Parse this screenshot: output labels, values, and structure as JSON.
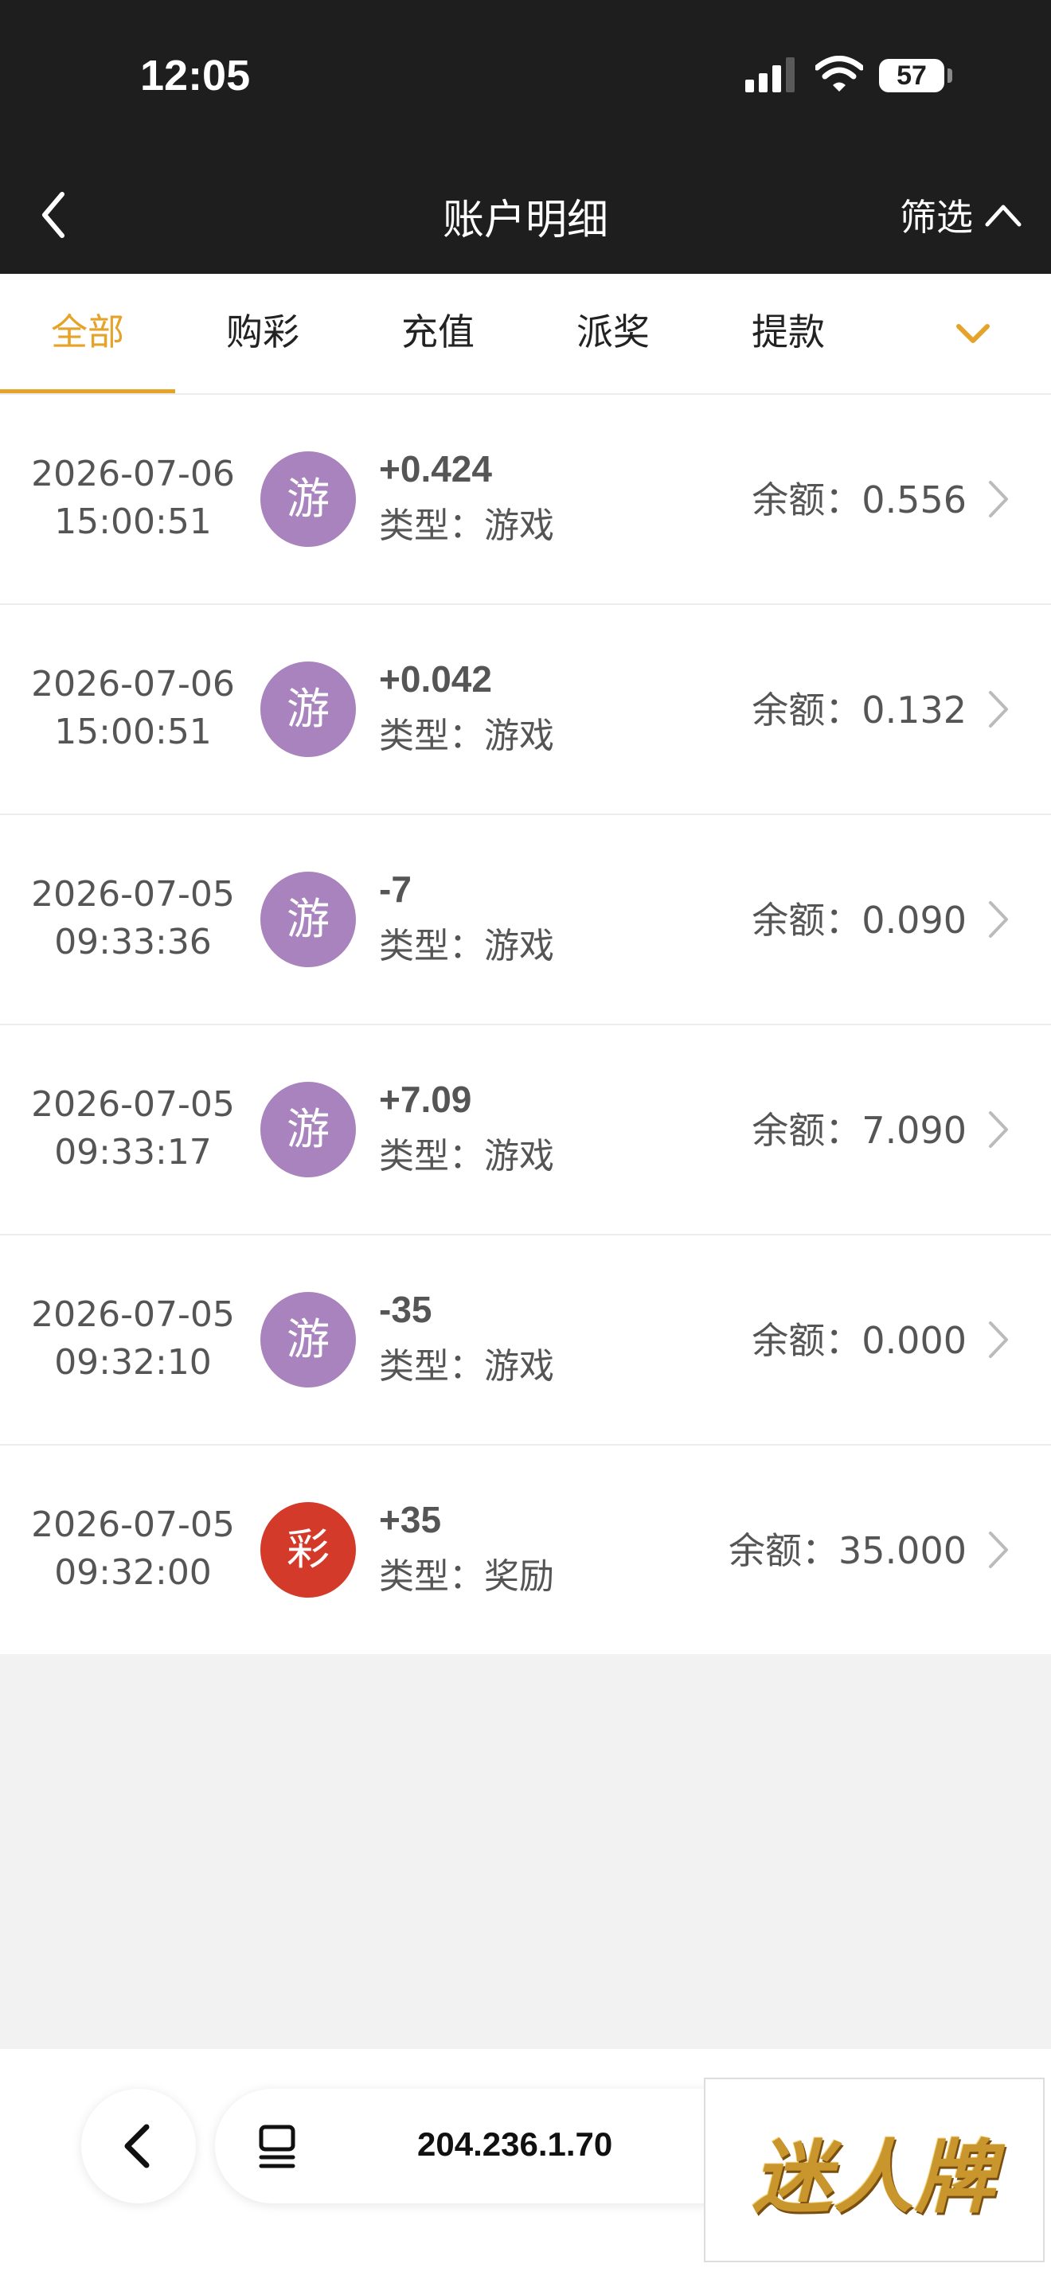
{
  "status_bar": {
    "time": "12:05",
    "battery": "57"
  },
  "navbar": {
    "title": "账户明细",
    "filter_label": "筛选"
  },
  "tabs": [
    {
      "label": "全部",
      "active": true
    },
    {
      "label": "购彩",
      "active": false
    },
    {
      "label": "充值",
      "active": false
    },
    {
      "label": "派奖",
      "active": false
    },
    {
      "label": "提款",
      "active": false
    }
  ],
  "records": [
    {
      "date": "2026-07-06",
      "time": "15:00:51",
      "badge": "游",
      "badge_color": "#a983bd",
      "amount": "+0.424",
      "type": "类型：游戏",
      "balance": "余额：0.556"
    },
    {
      "date": "2026-07-06",
      "time": "15:00:51",
      "badge": "游",
      "badge_color": "#a983bd",
      "amount": "+0.042",
      "type": "类型：游戏",
      "balance": "余额：0.132"
    },
    {
      "date": "2026-07-05",
      "time": "09:33:36",
      "badge": "游",
      "badge_color": "#a983bd",
      "amount": "-7",
      "type": "类型：游戏",
      "balance": "余额：0.090"
    },
    {
      "date": "2026-07-05",
      "time": "09:33:17",
      "badge": "游",
      "badge_color": "#a983bd",
      "amount": "+7.09",
      "type": "类型：游戏",
      "balance": "余额：7.090"
    },
    {
      "date": "2026-07-05",
      "time": "09:32:10",
      "badge": "游",
      "badge_color": "#a983bd",
      "amount": "-35",
      "type": "类型：游戏",
      "balance": "余额：0.000"
    },
    {
      "date": "2026-07-05",
      "time": "09:32:00",
      "badge": "彩",
      "badge_color": "#d33a2a",
      "amount": "+35",
      "type": "类型：奖励",
      "balance": "余额：35.000"
    }
  ],
  "browser": {
    "url": "204.236.1.70"
  },
  "logo": {
    "text": "迷人牌"
  },
  "colors": {
    "accent": "#e5a32a",
    "header_bg": "#1e1e1e"
  },
  "icons": {
    "back": "chevron-left-icon",
    "filter": "chevron-up-icon",
    "more_tabs": "chevron-down-icon",
    "row_arrow": "chevron-right-icon",
    "tabs_overview": "tabs-icon"
  }
}
